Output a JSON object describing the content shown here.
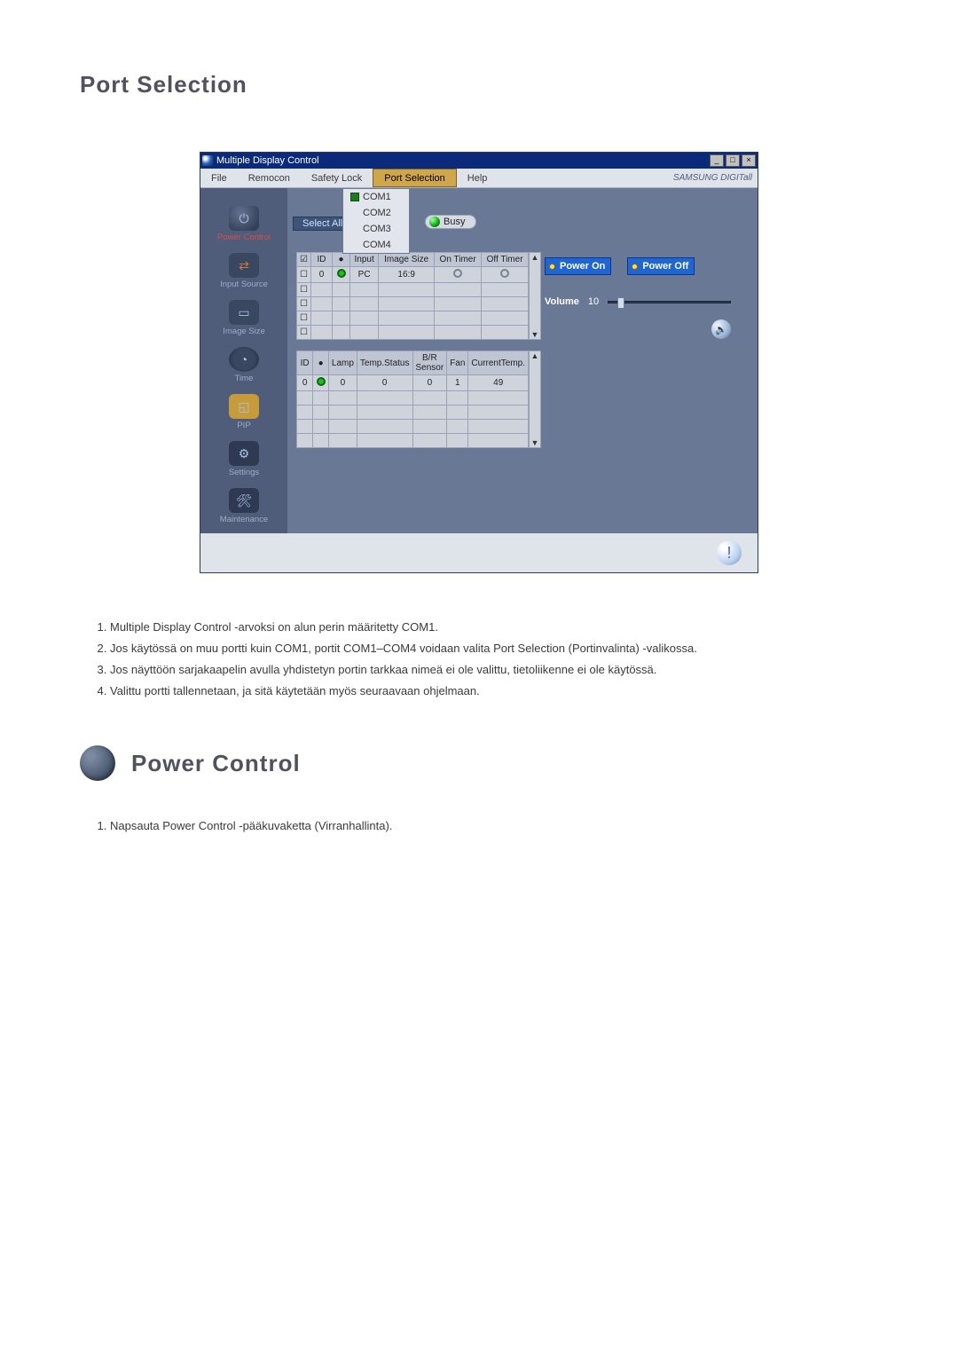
{
  "headings": {
    "port_selection": "Port Selection",
    "power_control": "Power Control"
  },
  "titlebar": {
    "title": "Multiple Display Control",
    "min": "_",
    "max": "□",
    "close": "×"
  },
  "menubar": {
    "file": "File",
    "remocon": "Remocon",
    "safety_lock": "Safety Lock",
    "port_selection": "Port Selection",
    "help": "Help",
    "brand": "SAMSUNG DIGITall"
  },
  "port_dropdown": {
    "com1": "COM1",
    "com2": "COM2",
    "com3": "COM3",
    "com4": "COM4"
  },
  "select_all": "Select All",
  "busy": "Busy",
  "sidebar": {
    "power_control": "Power Control",
    "input_source": "Input Source",
    "image_size": "Image Size",
    "time": "Time",
    "pip": "PIP",
    "settings": "Settings",
    "maintenance": "Maintenance"
  },
  "grid1": {
    "headers": {
      "cb": "☑",
      "id": "ID",
      "status": "",
      "input": "Input",
      "image_size": "Image Size",
      "on_timer": "On Timer",
      "off_timer": "Off Timer"
    },
    "row1": {
      "id": "0",
      "input": "PC",
      "image_size": "16:9"
    }
  },
  "grid2": {
    "headers": {
      "id": "ID",
      "status": "",
      "lamp": "Lamp",
      "temp_status": "Temp.Status",
      "br_sensor": "B/R Sensor",
      "fan": "Fan",
      "current_temp": "CurrentTemp."
    },
    "row1": {
      "id": "0",
      "lamp": "0",
      "temp_status": "0",
      "br_sensor": "0",
      "fan": "1",
      "current_temp": "49"
    }
  },
  "right_panel": {
    "power_on": "Power On",
    "power_off": "Power Off",
    "volume_label": "Volume",
    "volume_value": "10"
  },
  "scroll": {
    "up": "▲",
    "down": "▼"
  },
  "alert_glyph": "!",
  "notes_port": [
    "Multiple Display Control -arvoksi on alun perin määritetty COM1.",
    "Jos käytössä on muu portti kuin COM1, portit COM1–COM4 voidaan valita Port Selection (Portinvalinta) -valikossa.",
    "Jos näyttöön sarjakaapelin avulla yhdistetyn portin tarkkaa nimeä ei ole valittu, tietoliikenne ei ole käytössä.",
    "Valittu portti tallennetaan, ja sitä käytetään myös seuraavaan ohjelmaan."
  ],
  "notes_power": [
    "Napsauta Power Control -pääkuvaketta (Virranhallinta)."
  ]
}
